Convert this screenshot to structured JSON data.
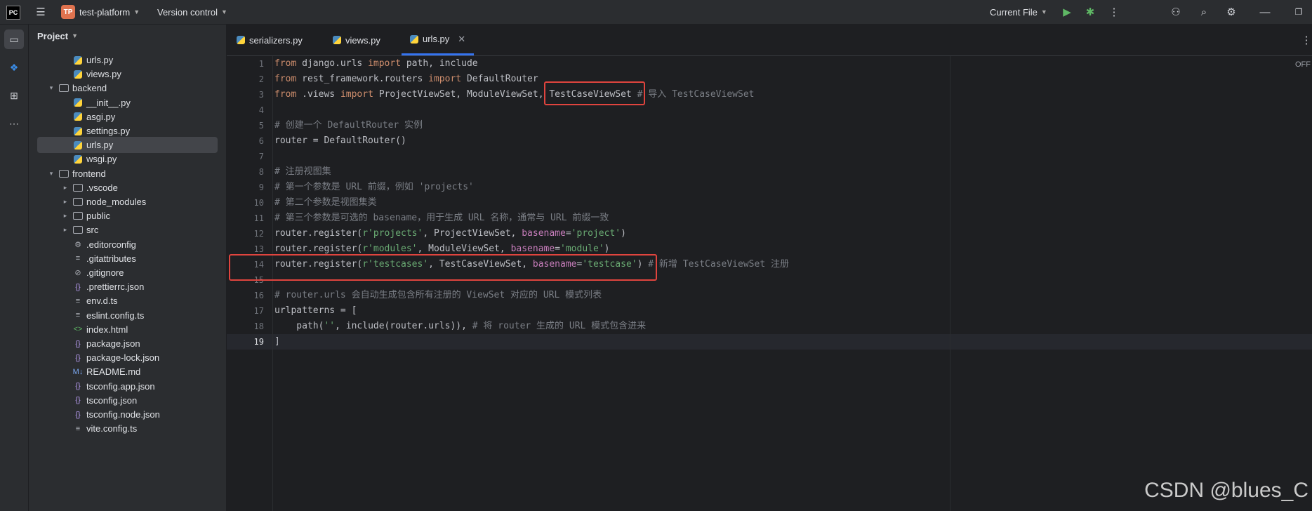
{
  "titlebar": {
    "app_logo": "PC",
    "project_badge": "TP",
    "project_name": "test-platform",
    "vcs": "Version control",
    "run_config": "Current File"
  },
  "project_panel": {
    "title": "Project",
    "items": [
      {
        "label": "urls.py",
        "icon": "python-file-icon"
      },
      {
        "label": "views.py",
        "icon": "python-file-icon"
      },
      {
        "label": "backend",
        "icon": "folder-icon"
      },
      {
        "label": "__init__.py",
        "icon": "python-file-icon"
      },
      {
        "label": "asgi.py",
        "icon": "python-file-icon"
      },
      {
        "label": "settings.py",
        "icon": "python-file-icon"
      },
      {
        "label": "urls.py",
        "icon": "python-file-icon"
      },
      {
        "label": "wsgi.py",
        "icon": "python-file-icon"
      },
      {
        "label": "frontend",
        "icon": "folder-icon"
      },
      {
        "label": ".vscode",
        "icon": "folder-icon"
      },
      {
        "label": "node_modules",
        "icon": "folder-icon"
      },
      {
        "label": "public",
        "icon": "folder-icon"
      },
      {
        "label": "src",
        "icon": "folder-icon"
      },
      {
        "label": ".editorconfig",
        "icon": "gear-icon"
      },
      {
        "label": ".gitattributes",
        "icon": "text-file-icon"
      },
      {
        "label": ".gitignore",
        "icon": "ignore-file-icon"
      },
      {
        "label": ".prettierrc.json",
        "icon": "json-file-icon"
      },
      {
        "label": "env.d.ts",
        "icon": "text-file-icon"
      },
      {
        "label": "eslint.config.ts",
        "icon": "text-file-icon"
      },
      {
        "label": "index.html",
        "icon": "html-file-icon"
      },
      {
        "label": "package.json",
        "icon": "json-file-icon"
      },
      {
        "label": "package-lock.json",
        "icon": "json-file-icon"
      },
      {
        "label": "README.md",
        "icon": "markdown-file-icon"
      },
      {
        "label": "tsconfig.app.json",
        "icon": "json-file-icon"
      },
      {
        "label": "tsconfig.json",
        "icon": "json-file-icon"
      },
      {
        "label": "tsconfig.node.json",
        "icon": "json-file-icon"
      },
      {
        "label": "vite.config.ts",
        "icon": "text-file-icon"
      }
    ]
  },
  "tabs": [
    {
      "label": "serializers.py"
    },
    {
      "label": "views.py"
    },
    {
      "label": "urls.py"
    }
  ],
  "editor": {
    "off_label": "OFF",
    "line_numbers": [
      "1",
      "2",
      "3",
      "4",
      "5",
      "6",
      "7",
      "8",
      "9",
      "10",
      "11",
      "12",
      "13",
      "14",
      "15",
      "16",
      "17",
      "18",
      "19"
    ],
    "lines": [
      [
        {
          "t": "from",
          "c": "kw"
        },
        {
          "t": " django.urls "
        },
        {
          "t": "import",
          "c": "kw"
        },
        {
          "t": " path, include"
        }
      ],
      [
        {
          "t": "from",
          "c": "kw"
        },
        {
          "t": " rest_framework.routers "
        },
        {
          "t": "import",
          "c": "kw"
        },
        {
          "t": " DefaultRouter"
        }
      ],
      [
        {
          "t": "from",
          "c": "kw"
        },
        {
          "t": " .views "
        },
        {
          "t": "import",
          "c": "kw"
        },
        {
          "t": " ProjectViewSet, ModuleViewSet, TestCaseViewSet "
        },
        {
          "t": "# 导入 TestCaseViewSet",
          "c": "cm"
        }
      ],
      [],
      [
        {
          "t": "# 创建一个 DefaultRouter 实例",
          "c": "cm"
        }
      ],
      [
        {
          "t": "router = DefaultRouter()"
        }
      ],
      [],
      [
        {
          "t": "# 注册视图集",
          "c": "cm"
        }
      ],
      [
        {
          "t": "# 第一个参数是 URL 前缀，例如 'projects'",
          "c": "cm"
        }
      ],
      [
        {
          "t": "# 第二个参数是视图集类",
          "c": "cm"
        }
      ],
      [
        {
          "t": "# 第三个参数是可选的 basename，用于生成 URL 名称，通常与 URL 前缀一致",
          "c": "cm"
        }
      ],
      [
        {
          "t": "router.register("
        },
        {
          "t": "r'projects'",
          "c": "str"
        },
        {
          "t": ", ProjectViewSet, "
        },
        {
          "t": "basename",
          "c": "cn"
        },
        {
          "t": "="
        },
        {
          "t": "'project'",
          "c": "str"
        },
        {
          "t": ")"
        }
      ],
      [
        {
          "t": "router.register("
        },
        {
          "t": "r'modules'",
          "c": "str"
        },
        {
          "t": ", ModuleViewSet, "
        },
        {
          "t": "basename",
          "c": "cn"
        },
        {
          "t": "="
        },
        {
          "t": "'module'",
          "c": "str"
        },
        {
          "t": ")"
        }
      ],
      [
        {
          "t": "router.register("
        },
        {
          "t": "r'testcases'",
          "c": "str"
        },
        {
          "t": ", TestCaseViewSet, "
        },
        {
          "t": "basename",
          "c": "cn"
        },
        {
          "t": "="
        },
        {
          "t": "'testcase'",
          "c": "str"
        },
        {
          "t": ") "
        },
        {
          "t": "# 新增 TestCaseViewSet 注册",
          "c": "cm"
        }
      ],
      [],
      [
        {
          "t": "# router.urls 会自动生成包含所有注册的 ViewSet 对应的 URL 模式列表",
          "c": "cm"
        }
      ],
      [
        {
          "t": "urlpatterns = ["
        }
      ],
      [
        {
          "t": "    path("
        },
        {
          "t": "''",
          "c": "str"
        },
        {
          "t": ", include(router.urls)), "
        },
        {
          "t": "# 将 router 生成的 URL 模式包含进来",
          "c": "cm"
        }
      ],
      [
        {
          "t": "]"
        }
      ]
    ]
  },
  "watermark": "CSDN @blues_C"
}
